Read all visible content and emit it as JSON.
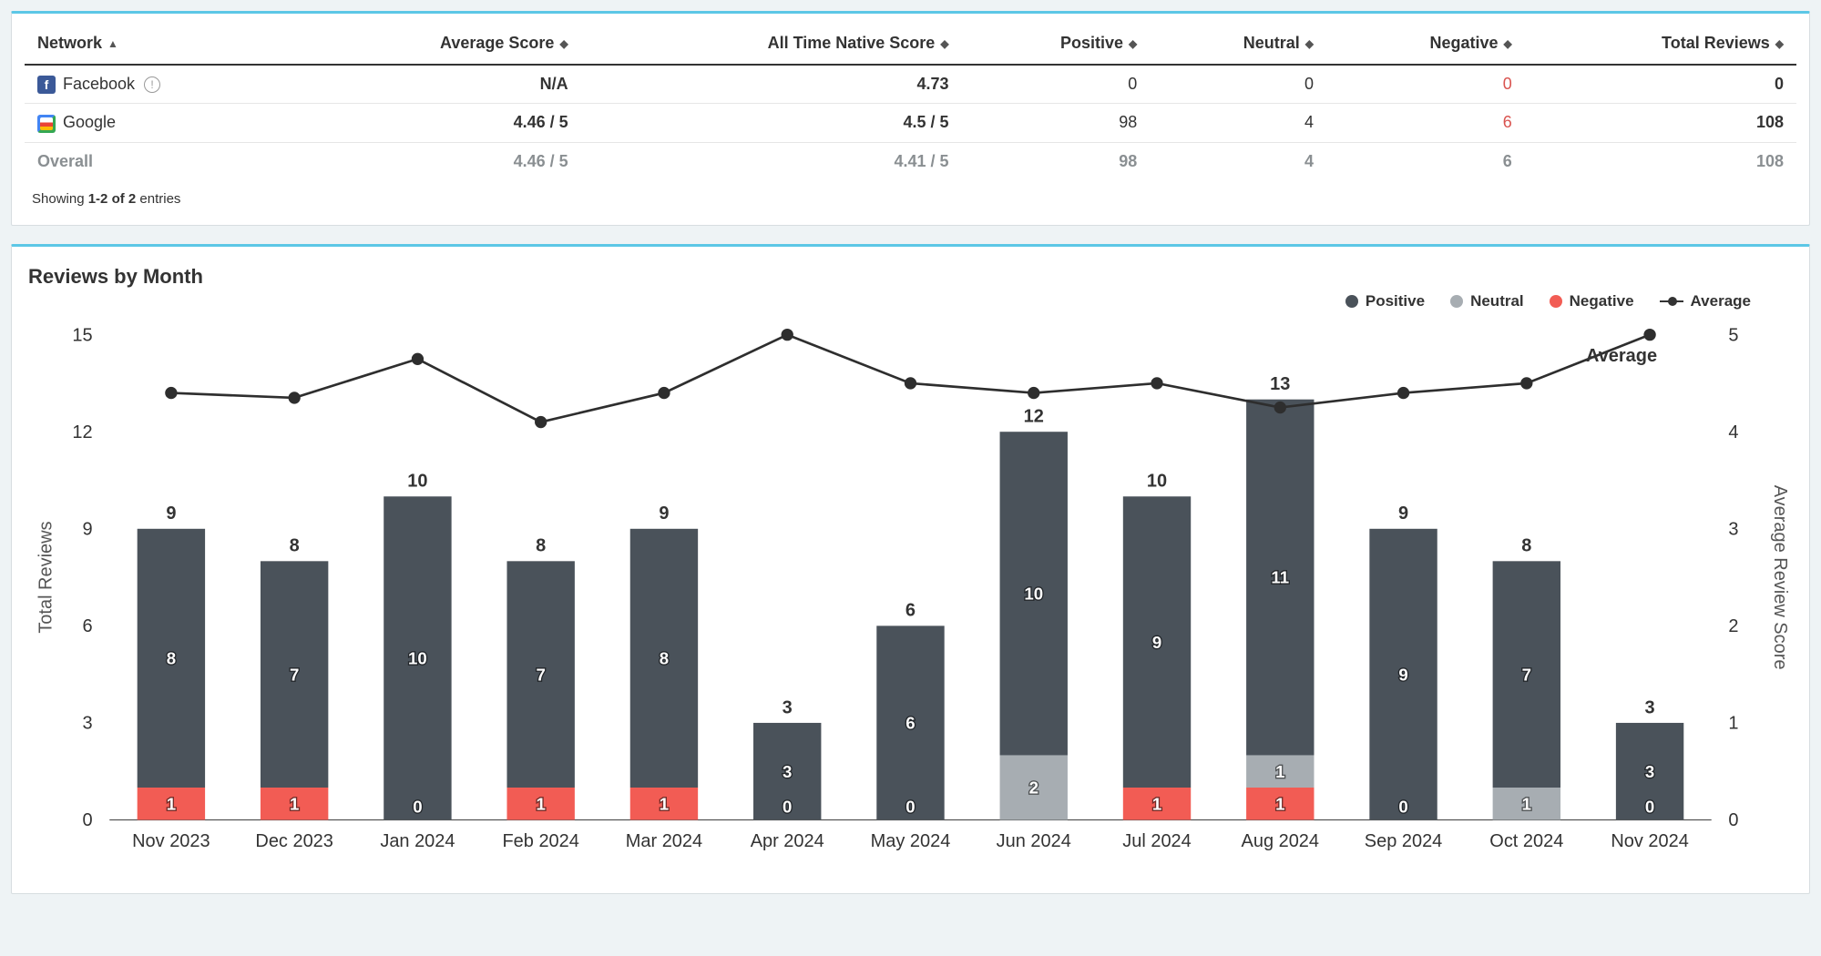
{
  "table": {
    "headers": {
      "network": "Network",
      "avg": "Average Score",
      "native": "All Time Native Score",
      "positive": "Positive",
      "neutral": "Neutral",
      "negative": "Negative",
      "total": "Total Reviews"
    },
    "rows": [
      {
        "network": "Facebook",
        "icon": "fb",
        "info": true,
        "avg": "N/A",
        "native": "4.73",
        "positive": "0",
        "neutral": "0",
        "negative": "0",
        "total": "0"
      },
      {
        "network": "Google",
        "icon": "goog",
        "info": false,
        "avg": "4.46 / 5",
        "native": "4.5 / 5",
        "positive": "98",
        "neutral": "4",
        "negative": "6",
        "total": "108"
      }
    ],
    "overall": {
      "network": "Overall",
      "avg": "4.46 / 5",
      "native": "4.41 / 5",
      "positive": "98",
      "neutral": "4",
      "negative": "6",
      "total": "108"
    },
    "entries_text_prefix": "Showing ",
    "entries_text_bold": "1-2 of 2",
    "entries_text_suffix": " entries"
  },
  "chart_title": "Reviews by Month",
  "legend": {
    "positive": "Positive",
    "neutral": "Neutral",
    "negative": "Negative",
    "average": "Average"
  },
  "colors": {
    "positive": "#4a525a",
    "neutral": "#a7adb2",
    "negative": "#f25c54",
    "line": "#2e2e2e"
  },
  "axes": {
    "y_left_label": "Total Reviews",
    "y_right_label": "Average Review Score",
    "avg_inline_label": "Average"
  },
  "chart_data": {
    "type": "bar",
    "categories": [
      "Nov 2023",
      "Dec 2023",
      "Jan 2024",
      "Feb 2024",
      "Mar 2024",
      "Apr 2024",
      "May 2024",
      "Jun 2024",
      "Jul 2024",
      "Aug 2024",
      "Sep 2024",
      "Oct 2024",
      "Nov 2024"
    ],
    "series": [
      {
        "name": "Negative",
        "values": [
          1,
          1,
          0,
          1,
          1,
          0,
          0,
          0,
          1,
          1,
          0,
          0,
          0
        ]
      },
      {
        "name": "Neutral",
        "values": [
          0,
          0,
          0,
          0,
          0,
          0,
          0,
          2,
          0,
          1,
          0,
          1,
          0
        ]
      },
      {
        "name": "Positive",
        "values": [
          8,
          7,
          10,
          7,
          8,
          3,
          6,
          10,
          9,
          11,
          9,
          7,
          3
        ]
      }
    ],
    "totals": [
      9,
      8,
      10,
      8,
      9,
      3,
      6,
      12,
      10,
      13,
      9,
      8,
      3
    ],
    "average_line": [
      4.4,
      4.35,
      4.75,
      4.1,
      4.4,
      5.0,
      4.5,
      4.4,
      4.5,
      4.25,
      4.4,
      4.5,
      5.0
    ],
    "y_left": {
      "min": 0,
      "max": 15,
      "ticks": [
        0,
        3,
        6,
        9,
        12,
        15
      ]
    },
    "y_right": {
      "min": 0,
      "max": 5,
      "ticks": [
        0,
        1,
        2,
        3,
        4,
        5
      ]
    }
  }
}
